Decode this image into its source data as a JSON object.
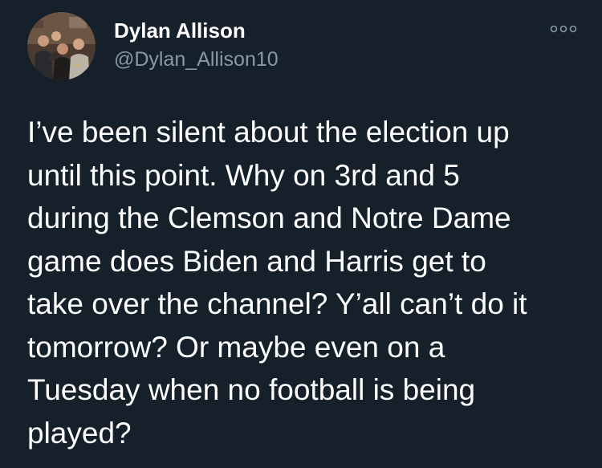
{
  "author": {
    "name": "Dylan Allison",
    "handle": "@Dylan_Allison10",
    "avatar_icon": "profile-photo-group"
  },
  "more_menu": {
    "icon": "more-horizontal-icon"
  },
  "tweet": {
    "text": "I’ve been silent about the election up\nuntil this point. Why on 3rd and 5\nduring the Clemson and Notre Dame\ngame does Biden and Harris get to\ntake over the channel? Y’all can’t do it\ntomorrow? Or maybe even on a\nTuesday when no football is being\nplayed?"
  },
  "colors": {
    "background": "#15202b",
    "primary_text": "#ffffff",
    "secondary_text": "#8899a6"
  }
}
